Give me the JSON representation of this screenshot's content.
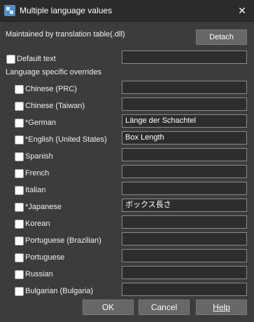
{
  "window": {
    "title": "Multiple language values",
    "close_glyph": "✕"
  },
  "maintained_label": "Maintained by translation table(.dll)",
  "detach_label": "Detach",
  "default_text": {
    "label": "Default text",
    "value": ""
  },
  "overrides_header": "Language specific overrides",
  "languages": [
    {
      "label": "Chinese (PRC)",
      "value": ""
    },
    {
      "label": "Chinese (Taiwan)",
      "value": ""
    },
    {
      "label": "*German",
      "value": "Länge der Schachtel"
    },
    {
      "label": "*English (United States)",
      "value": "Box Length"
    },
    {
      "label": "Spanish",
      "value": ""
    },
    {
      "label": "French",
      "value": ""
    },
    {
      "label": "Italian",
      "value": ""
    },
    {
      "label": "*Japanese",
      "value": "ボックス長さ"
    },
    {
      "label": "Korean",
      "value": ""
    },
    {
      "label": "Portuguese (Brazilian)",
      "value": ""
    },
    {
      "label": "Portuguese",
      "value": ""
    },
    {
      "label": "Russian",
      "value": ""
    },
    {
      "label": "Bulgarian (Bulgaria)",
      "value": ""
    }
  ],
  "buttons": {
    "ok": "OK",
    "cancel": "Cancel",
    "help": "Help"
  }
}
